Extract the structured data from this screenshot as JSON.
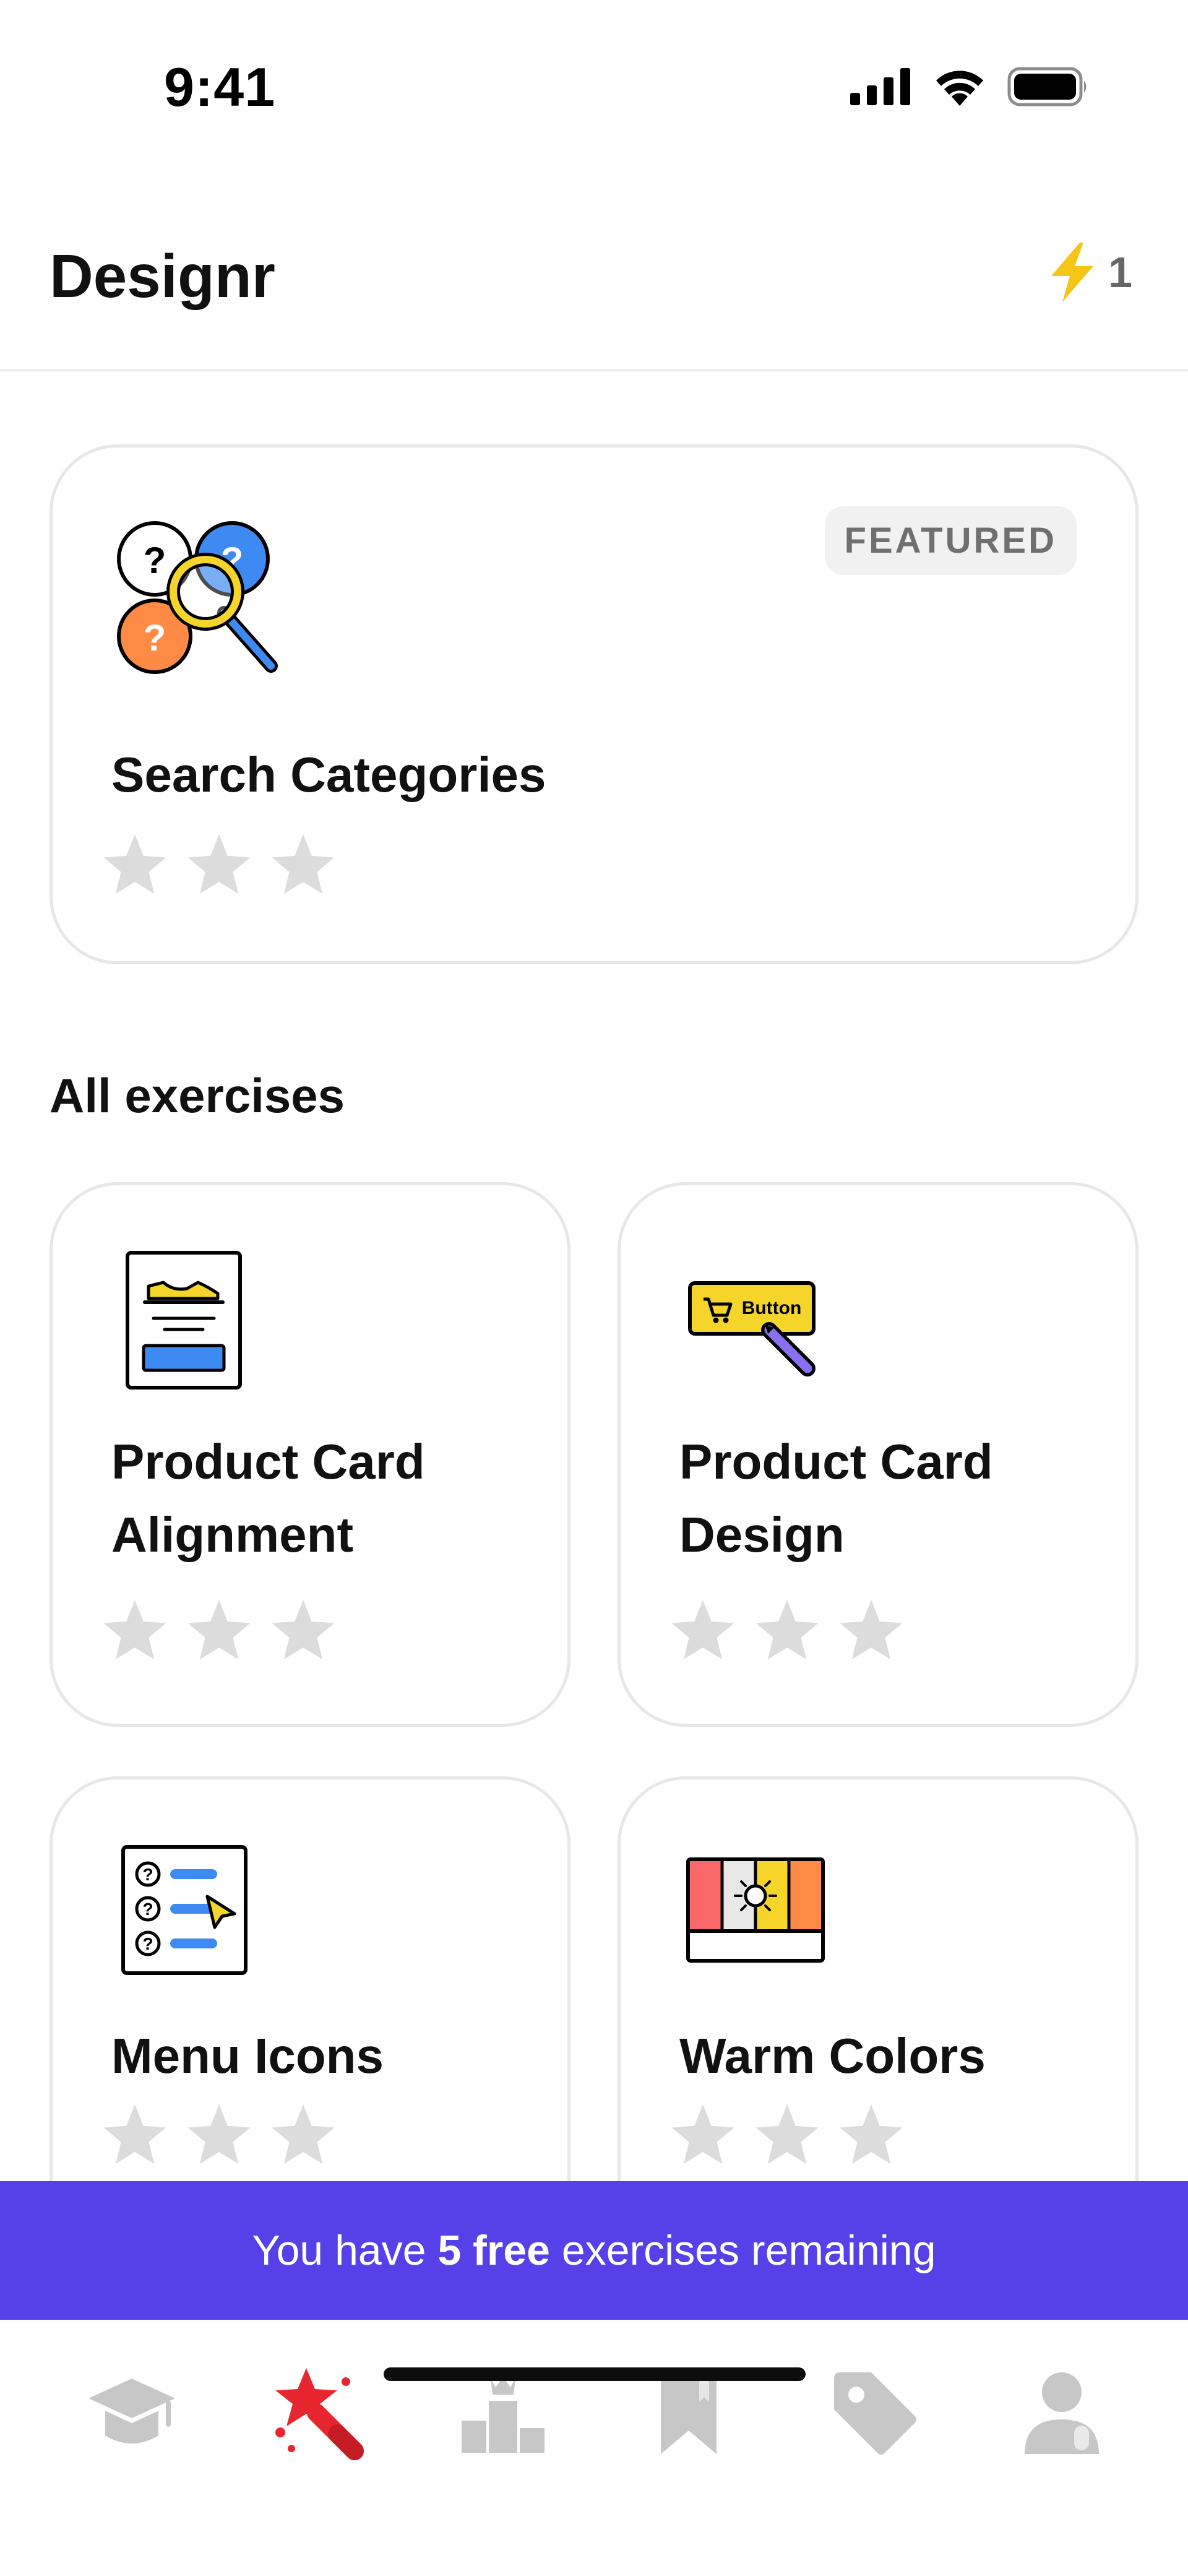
{
  "status_bar": {
    "time": "9:41"
  },
  "header": {
    "title": "Designr",
    "energy_count": "1",
    "energy_icon": "lightning-bolt-icon",
    "accent_color": "#F5C518"
  },
  "featured": {
    "badge": "FEATURED",
    "title": "Search Categories",
    "icon": "search-categories-illustration",
    "stars_filled": 0,
    "stars_total": 3
  },
  "section": {
    "heading": "All exercises"
  },
  "exercises": [
    {
      "title_line1": "Product Card",
      "title_line2": "Alignment",
      "icon": "product-card-alignment-illustration",
      "stars_filled": 0,
      "stars_total": 3
    },
    {
      "title_line1": "Product Card",
      "title_line2": "Design",
      "icon": "product-card-design-illustration",
      "button_text": "Button",
      "stars_filled": 0,
      "stars_total": 3
    },
    {
      "title_line1": "Menu Icons",
      "title_line2": "",
      "icon": "menu-icons-illustration",
      "stars_filled": 0,
      "stars_total": 3
    },
    {
      "title_line1": "Warm Colors",
      "title_line2": "",
      "icon": "warm-colors-illustration",
      "stars_filled": 0,
      "stars_total": 3
    }
  ],
  "banner": {
    "prefix": "You have ",
    "highlight": "5 free",
    "suffix": " exercises remaining",
    "color": "#5640E8"
  },
  "tab_bar": {
    "tabs": [
      {
        "icon": "graduation-cap-icon",
        "active": false
      },
      {
        "icon": "star-wand-icon",
        "active": true
      },
      {
        "icon": "podium-icon",
        "active": false
      },
      {
        "icon": "bookmark-icon",
        "active": false
      },
      {
        "icon": "tag-icon",
        "active": false
      },
      {
        "icon": "profile-icon",
        "active": false
      }
    ],
    "active_color": "#E8262F",
    "inactive_color": "#C7C7C7"
  }
}
